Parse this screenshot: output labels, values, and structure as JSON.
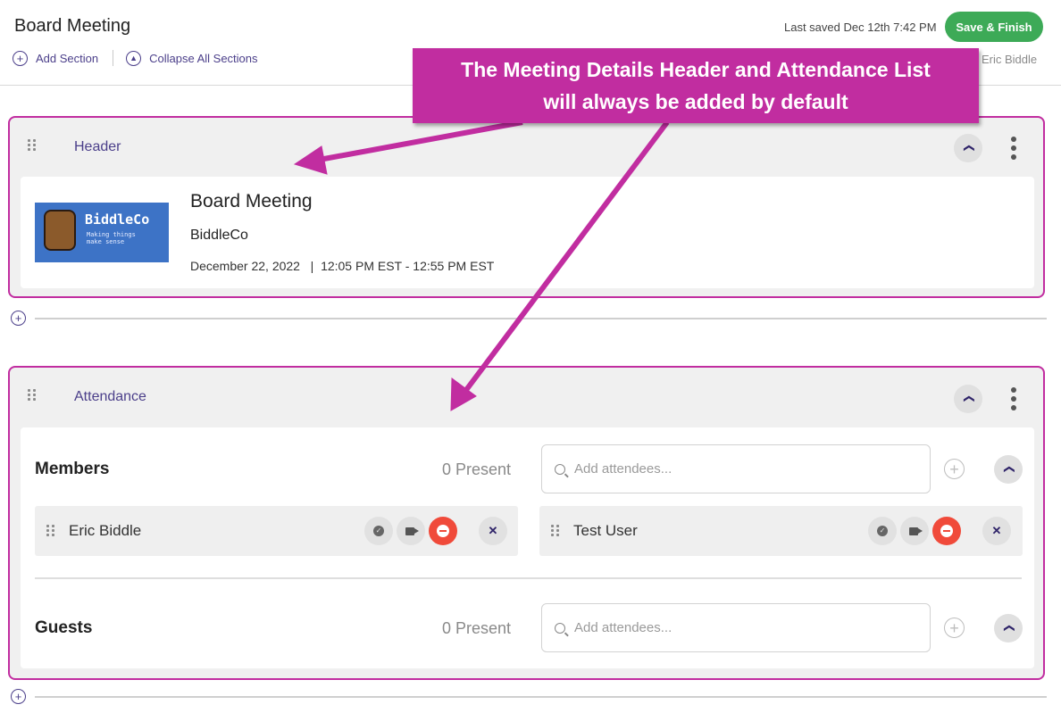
{
  "header": {
    "title": "Board Meeting",
    "add_section": "Add Section",
    "collapse_all": "Collapse All Sections",
    "last_saved": "Last saved Dec 12th 7:42 PM",
    "save_button": "Save & Finish",
    "user": "Eric Biddle"
  },
  "annotation": {
    "line1": "The Meeting Details Header and Attendance List",
    "line2": "will always be added by default"
  },
  "header_section": {
    "title": "Header",
    "logo_text": "BiddleCo",
    "logo_tagline": "Making things make sense",
    "meeting_title": "Board Meeting",
    "organization": "BiddleCo",
    "date": "December 22, 2022",
    "time": "12:05 PM EST - 12:55 PM EST"
  },
  "attendance_section": {
    "title": "Attendance",
    "members": {
      "title": "Members",
      "present": "0 Present",
      "placeholder": "Add attendees...",
      "people": [
        {
          "name": "Eric Biddle"
        },
        {
          "name": "Test User"
        }
      ]
    },
    "guests": {
      "title": "Guests",
      "present": "0 Present",
      "placeholder": "Add attendees..."
    }
  },
  "colors": {
    "accent": "#4b3f8a",
    "save_green": "#3daa57",
    "annotation_magenta": "#c12da0",
    "absent_red": "#f04a3a"
  }
}
